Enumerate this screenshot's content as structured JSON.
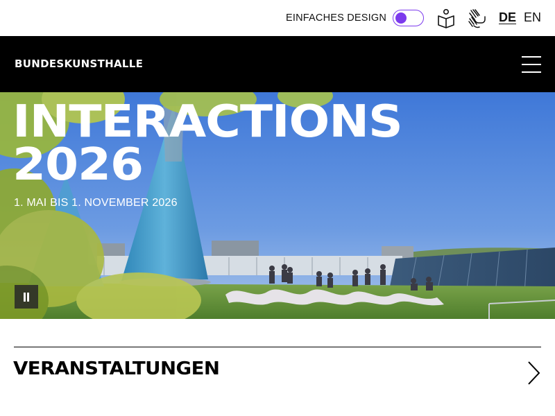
{
  "utility": {
    "simple_design_label": "EINFACHES DESIGN",
    "simple_design_toggle_color": "#7c3aed",
    "icons": [
      "easy-read-book-icon",
      "sign-language-hands-icon"
    ],
    "languages": [
      {
        "code": "DE",
        "active": true
      },
      {
        "code": "EN",
        "active": false
      }
    ]
  },
  "header": {
    "brand": "BUNDESKUNSTHALLE",
    "menu_icon": "hamburger-menu-icon"
  },
  "hero": {
    "title_line1": "INTERACTIONS",
    "title_line2": "2026",
    "dates": "1. MAI BIS 1. NOVEMBER 2026",
    "pause_icon": "pause-icon"
  },
  "section": {
    "title": "VERANSTALTUNGEN",
    "arrow_icon": "chevron-right-icon"
  },
  "colors": {
    "header_bg": "#000000",
    "accent": "#7c3aed"
  }
}
